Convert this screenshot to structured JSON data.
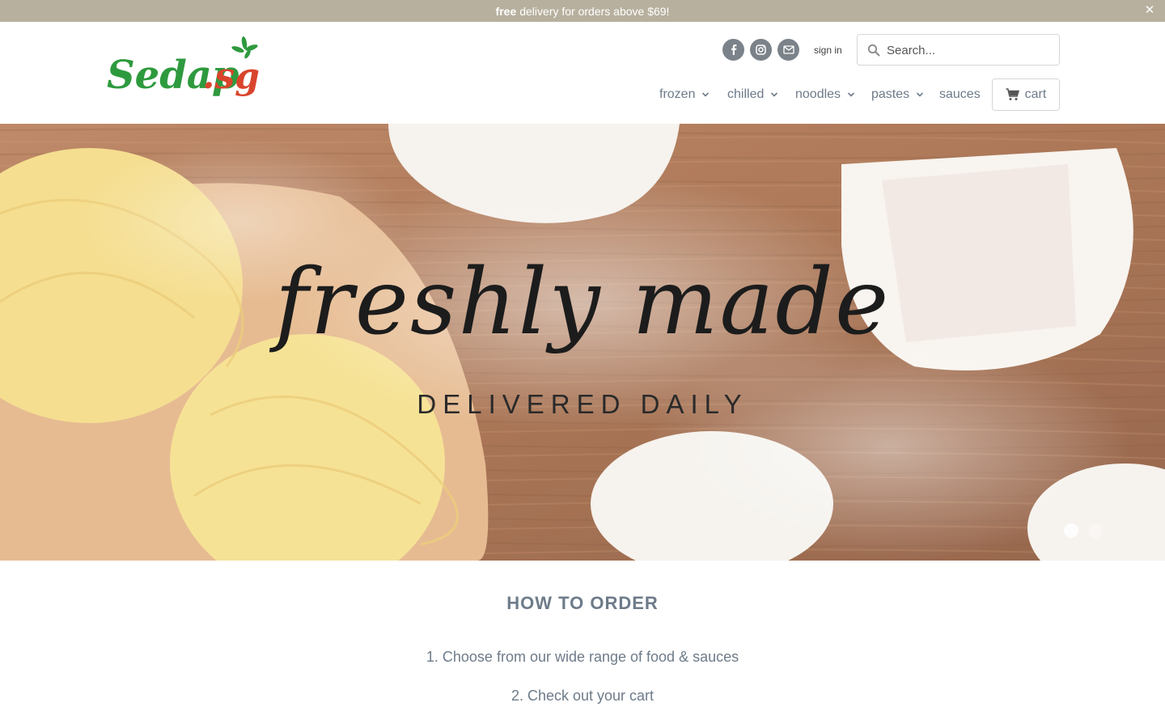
{
  "announcement": {
    "bold": "free",
    "text": "delivery for orders above $69!",
    "close_icon": "close-icon"
  },
  "brand": {
    "logo_text_main": "Sedap",
    "logo_text_suffix": ".sg",
    "colors": {
      "green": "#2e9a3e",
      "red": "#d9452c"
    }
  },
  "header": {
    "social_icons": [
      "facebook-icon",
      "instagram-icon",
      "mail-icon"
    ],
    "signin_label": "sign in",
    "search_placeholder": "Search..."
  },
  "nav": {
    "items": [
      {
        "label": "frozen",
        "has_dropdown": true
      },
      {
        "label": "chilled",
        "has_dropdown": true
      },
      {
        "label": "noodles",
        "has_dropdown": true
      },
      {
        "label": "pastes",
        "has_dropdown": true
      },
      {
        "label": "sauces",
        "has_dropdown": false
      }
    ],
    "cart_label": "cart"
  },
  "hero": {
    "headline": "freshly made",
    "subheadline": "DELIVERED DAILY",
    "slide_count": 2,
    "active_slide": 1
  },
  "how_to_order": {
    "title": "HOW TO ORDER",
    "steps": [
      "1. Choose from our wide range of food & sauces",
      "2. Check out your cart"
    ]
  },
  "colors": {
    "announce_bg": "#b7b09e",
    "text": "#6e7b89",
    "wood": "#9a5a33"
  }
}
